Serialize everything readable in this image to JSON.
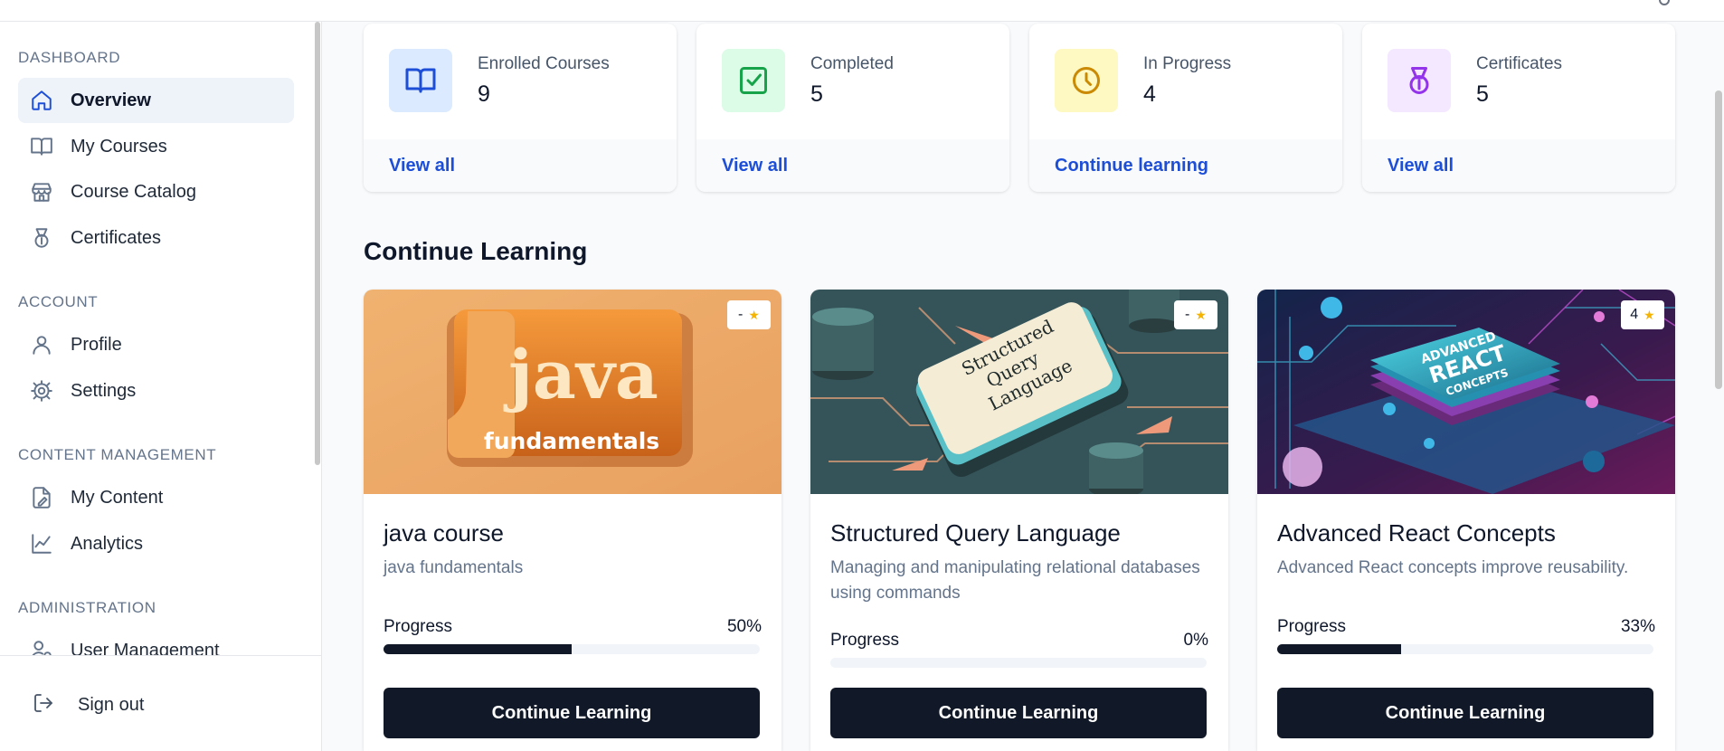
{
  "sidebar": {
    "sections": [
      {
        "title": "DASHBOARD",
        "items": [
          {
            "label": "Overview",
            "icon": "home-icon",
            "active": true
          },
          {
            "label": "My Courses",
            "icon": "book-open-icon"
          },
          {
            "label": "Course Catalog",
            "icon": "store-icon"
          },
          {
            "label": "Certificates",
            "icon": "medal-icon"
          }
        ]
      },
      {
        "title": "ACCOUNT",
        "items": [
          {
            "label": "Profile",
            "icon": "user-icon"
          },
          {
            "label": "Settings",
            "icon": "gear-icon"
          }
        ]
      },
      {
        "title": "CONTENT MANAGEMENT",
        "items": [
          {
            "label": "My Content",
            "icon": "file-edit-icon"
          },
          {
            "label": "Analytics",
            "icon": "chart-line-icon"
          }
        ]
      },
      {
        "title": "ADMINISTRATION",
        "items": [
          {
            "label": "User Management",
            "icon": "users-cog-icon"
          }
        ]
      }
    ],
    "sign_out": "Sign out"
  },
  "stats": [
    {
      "label": "Enrolled Courses",
      "value": "9",
      "link": "View all",
      "icon": "book-open-icon",
      "color": "#1d4ed8",
      "bg": "#dbeafe"
    },
    {
      "label": "Completed",
      "value": "5",
      "link": "View all",
      "icon": "check-square-icon",
      "color": "#16a34a",
      "bg": "#dcfce7"
    },
    {
      "label": "In Progress",
      "value": "4",
      "link": "Continue learning",
      "icon": "clock-icon",
      "color": "#ca8a04",
      "bg": "#fef9c3"
    },
    {
      "label": "Certificates",
      "value": "5",
      "link": "View all",
      "icon": "medal-icon",
      "color": "#9333ea",
      "bg": "#f3e8ff"
    }
  ],
  "continue_heading": "Continue Learning",
  "courses": [
    {
      "title": "java course",
      "description": "java fundamentals",
      "rating": "-",
      "progress_label": "Progress",
      "progress_text": "50%",
      "progress": 50,
      "button": "Continue Learning",
      "thumb_text_1": "java",
      "thumb_text_2": "fundamentals"
    },
    {
      "title": "Structured Query Language",
      "description": "Managing and manipulating relational databases using commands",
      "rating": "-",
      "progress_label": "Progress",
      "progress_text": "0%",
      "progress": 0,
      "button": "Continue Learning",
      "thumb_text_1": "Structured",
      "thumb_text_2": "Query",
      "thumb_text_3": "Language"
    },
    {
      "title": "Advanced React Concepts",
      "description": "Advanced React concepts improve reusability.",
      "rating": "4",
      "progress_label": "Progress",
      "progress_text": "33%",
      "progress": 33,
      "button": "Continue Learning",
      "thumb_text_1": "ADVANCED",
      "thumb_text_2": "REACT",
      "thumb_text_3": "CONCEPTS"
    }
  ]
}
